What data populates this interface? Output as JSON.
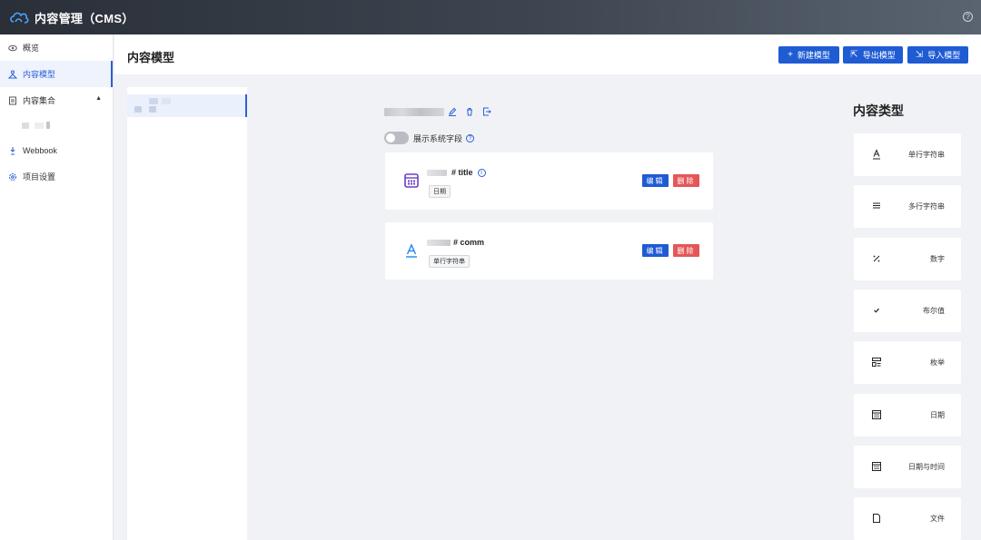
{
  "app": {
    "title": "内容管理（CMS）"
  },
  "sidebar": {
    "items": [
      {
        "label": "概览",
        "icon": "eye-icon"
      },
      {
        "label": "内容模型",
        "icon": "model-icon"
      },
      {
        "label": "内容集合",
        "icon": "collection-icon"
      },
      {
        "label": "Webbook",
        "icon": "webhook-icon"
      },
      {
        "label": "项目设置",
        "icon": "settings-icon"
      }
    ]
  },
  "header": {
    "page_title": "内容模型",
    "buttons": {
      "new_model": "新建模型",
      "export_model": "导出模型",
      "import_model": "导入模型"
    }
  },
  "model": {
    "show_system_fields": "展示系统字段"
  },
  "fields": [
    {
      "name": "# title",
      "type_tag": "日期",
      "edit": "编辑",
      "delete": "删除"
    },
    {
      "name": "# comm",
      "type_tag": "单行字符串",
      "edit": "编辑",
      "delete": "删除"
    }
  ],
  "types_panel": {
    "title": "内容类型",
    "types": [
      {
        "label": "单行字符串",
        "icon": "single-line-text-icon"
      },
      {
        "label": "多行字符串",
        "icon": "multi-line-text-icon"
      },
      {
        "label": "数字",
        "icon": "percent-icon"
      },
      {
        "label": "布尔值",
        "icon": "check-icon"
      },
      {
        "label": "枚举",
        "icon": "enum-icon"
      },
      {
        "label": "日期",
        "icon": "calendar-icon"
      },
      {
        "label": "日期与时间",
        "icon": "datetime-icon"
      },
      {
        "label": "文件",
        "icon": "file-icon"
      }
    ]
  },
  "colors": {
    "primary": "#1f5bd3",
    "danger": "#e55757",
    "topbar": "#2a2f38"
  }
}
